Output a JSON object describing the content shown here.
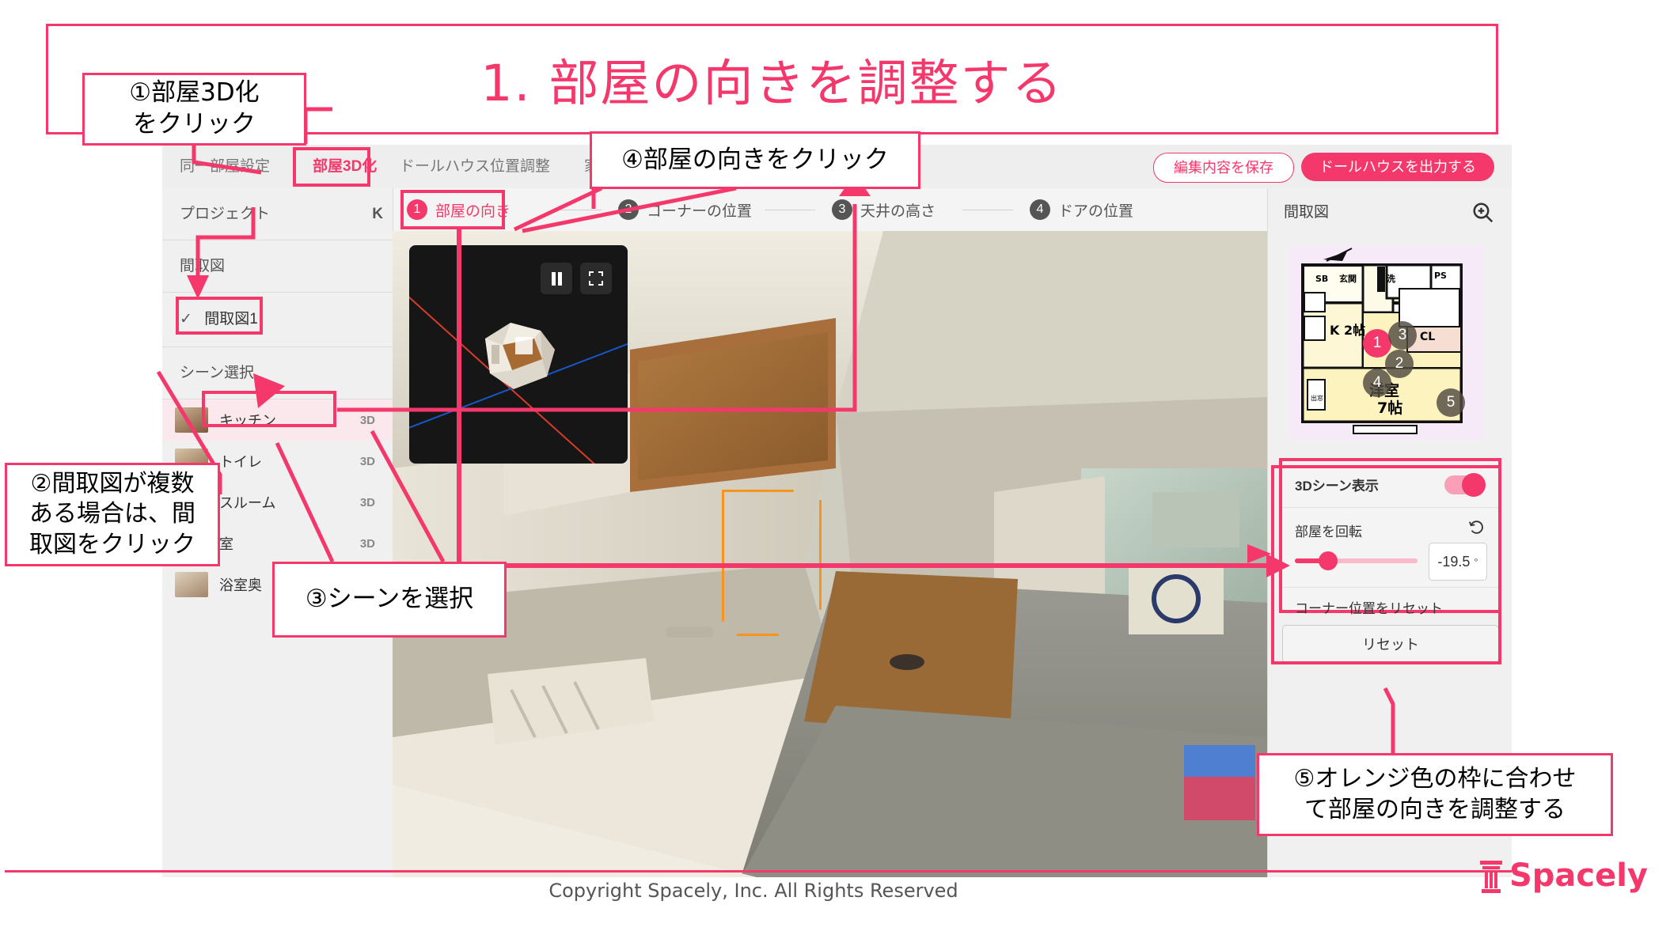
{
  "slide": {
    "title": "1. 部屋の向きを調整する",
    "footer_copyright": "Copyright Spacely, Inc. All Rights Reserved",
    "logo_text": "Spacely",
    "accent_color": "#f4386b",
    "orange_color": "#f7941e"
  },
  "toolbar": {
    "tabs": [
      {
        "label": "同一部屋設定",
        "active": false
      },
      {
        "label": "部屋3D化",
        "active": true
      },
      {
        "label": "ドールハウス位置調整",
        "active": false
      },
      {
        "label": "家",
        "active": false
      }
    ],
    "save_label": "編集内容を保存",
    "export_label": "ドールハウスを出力する"
  },
  "steps": [
    {
      "num": "1",
      "label": "部屋の向き",
      "active": true
    },
    {
      "num": "2",
      "label": "コーナーの位置",
      "active": false
    },
    {
      "num": "3",
      "label": "天井の高さ",
      "active": false
    },
    {
      "num": "4",
      "label": "ドアの位置",
      "active": false
    }
  ],
  "sidebar": {
    "project_label": "プロジェクト",
    "project_value": "K",
    "floorplan_header": "間取図",
    "floorplan_item": "間取図1",
    "floorplan_check": "✓",
    "scene_header": "シーン選択",
    "scenes": [
      {
        "name": "キッチン",
        "badge": "3D",
        "selected": true
      },
      {
        "name": "トイレ",
        "badge": "3D",
        "selected": false
      },
      {
        "name": "スルーム",
        "badge": "3D",
        "selected": false
      },
      {
        "name": "室",
        "badge": "3D",
        "selected": false
      },
      {
        "name": "浴室奥",
        "badge": "",
        "selected": false
      }
    ]
  },
  "preview3d": {
    "pause_icon": "pause-icon",
    "fullscreen_icon": "fullscreen-icon"
  },
  "right_panel": {
    "title": "間取図",
    "zoom_icon": "magnifier-plus-icon",
    "floorplan_labels": [
      "SB",
      "玄関",
      "洗",
      "PS",
      "K 2帖",
      "CL",
      "洋室",
      "7帖",
      "出窓"
    ],
    "floorplan_markers": [
      "1",
      "2",
      "3",
      "4",
      "5"
    ],
    "toggle_label": "3Dシーン表示",
    "toggle_on": true,
    "rotate_label": "部屋を回転",
    "rotate_reset_icon": "rotate-ccw-icon",
    "angle_value": "-19.5",
    "angle_unit": "°",
    "corner_reset_label": "コーナー位置をリセット",
    "reset_label": "リセット"
  },
  "annotations": {
    "callout1": "①部屋3D化\nをクリック",
    "callout2": "②間取図が複数\nある場合は、間\n取図をクリック",
    "callout3": "③シーンを選択",
    "callout4": "④部屋の向きをクリック",
    "callout5": "⑤オレンジ色の枠に合わせ\nて部屋の向きを調整する"
  }
}
